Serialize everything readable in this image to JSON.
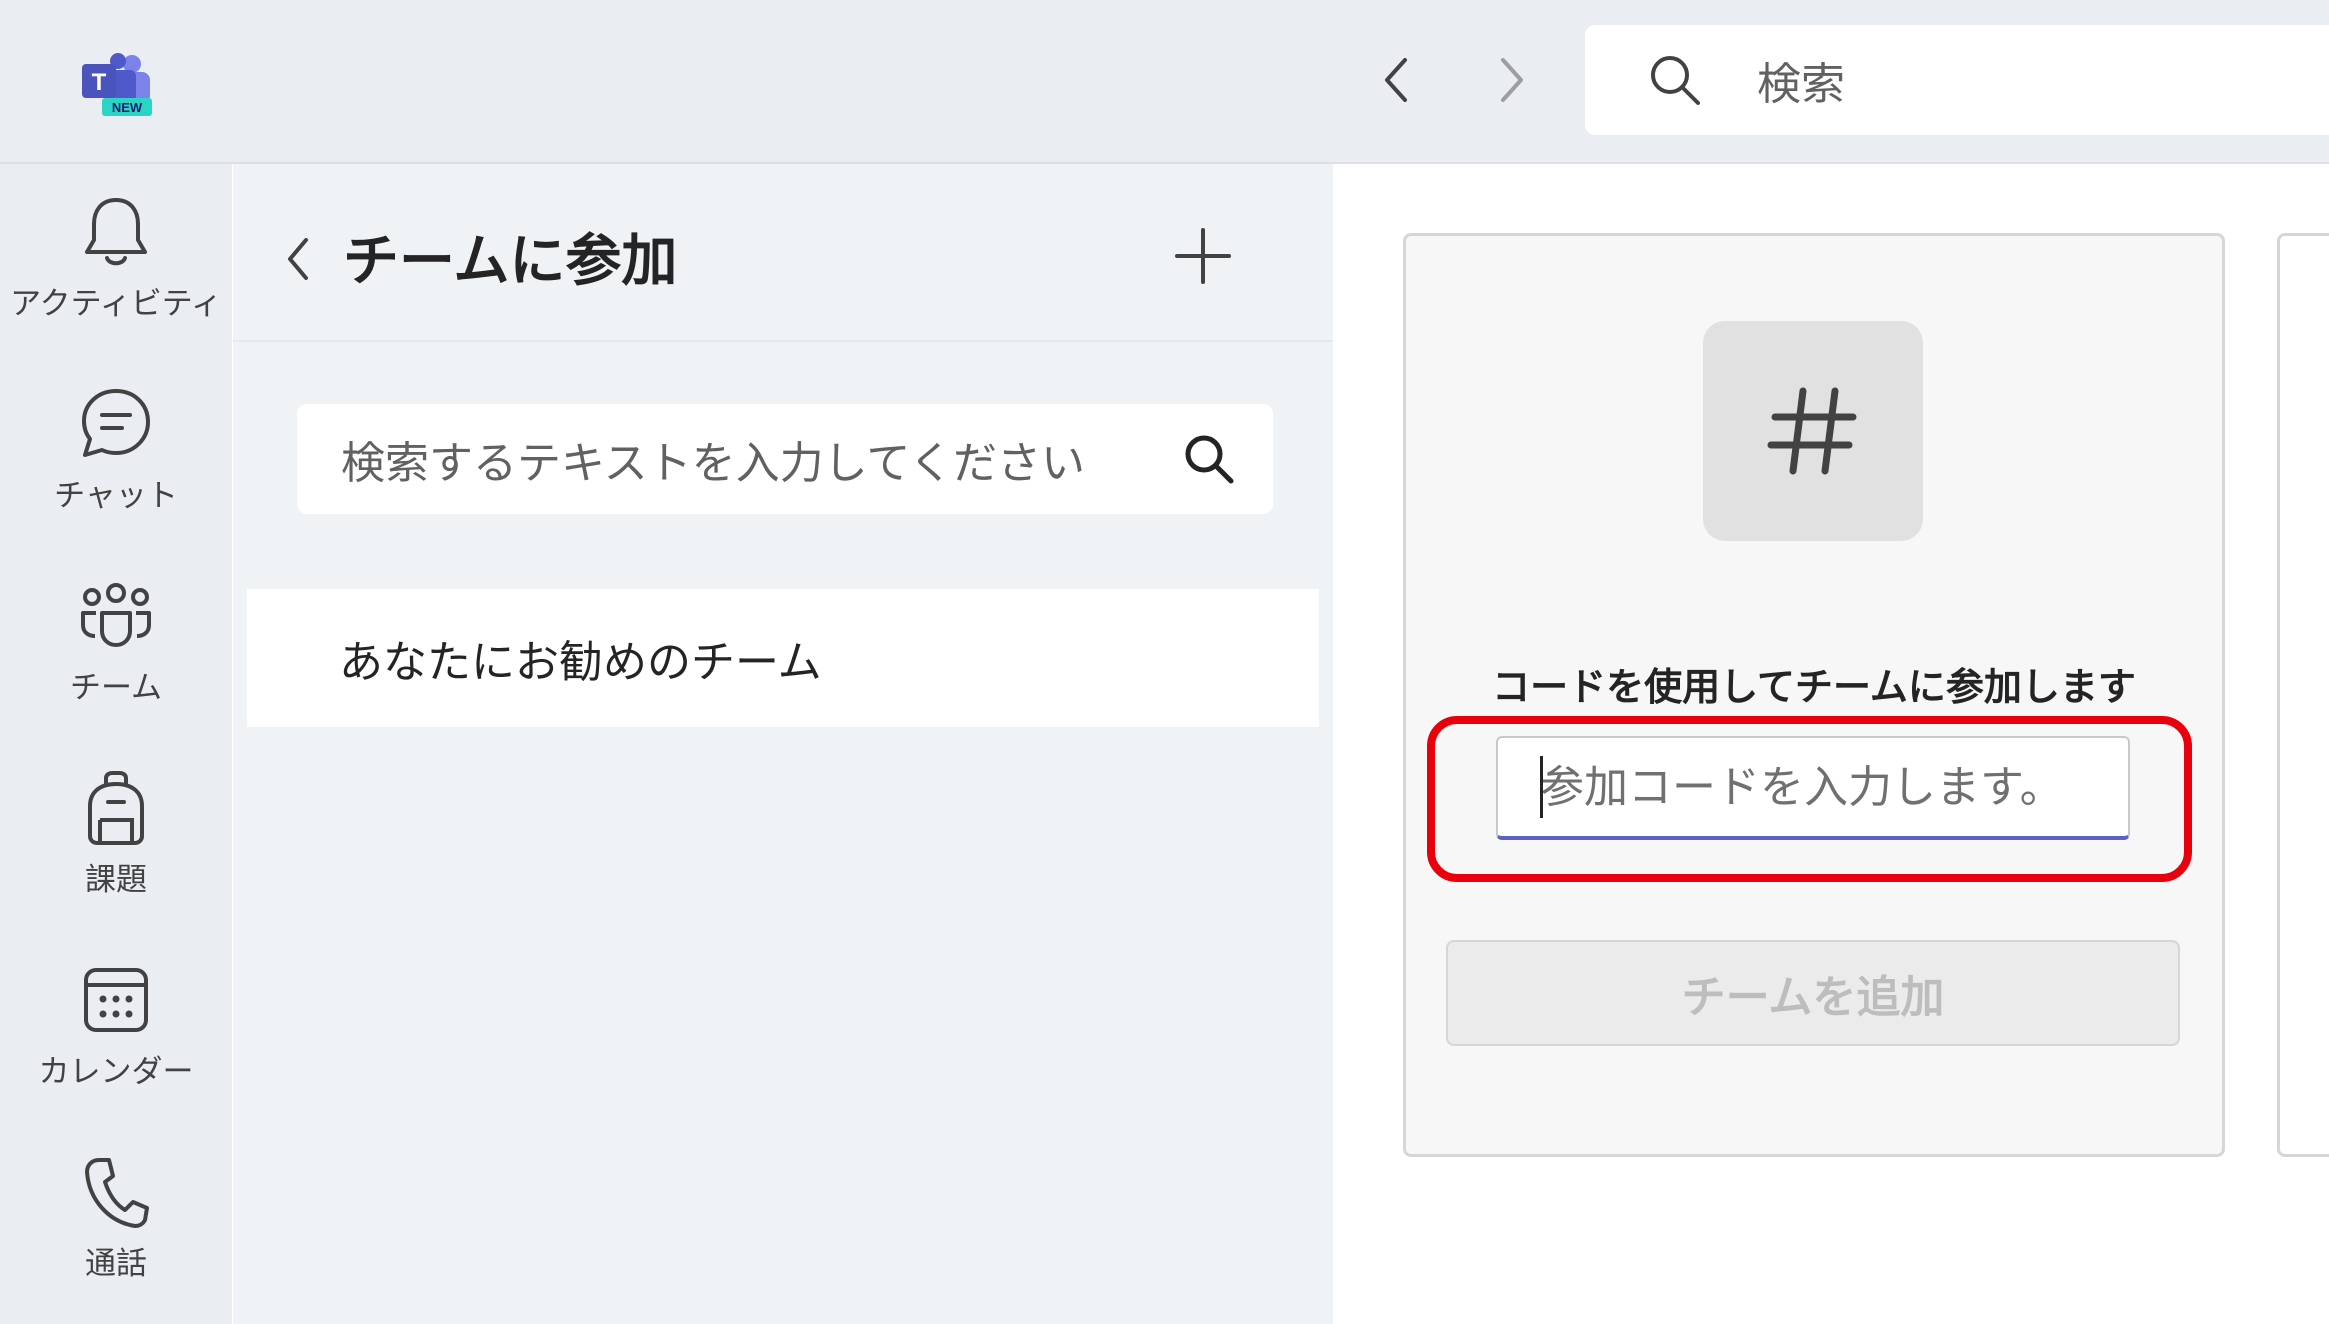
{
  "app": {
    "logo_badge": "NEW",
    "logo_letter": "T"
  },
  "topbar": {
    "search_placeholder": "検索"
  },
  "rail": {
    "items": [
      {
        "label": "アクティビティ",
        "icon": "bell-icon"
      },
      {
        "label": "チャット",
        "icon": "chat-icon"
      },
      {
        "label": "チーム",
        "icon": "teams-icon"
      },
      {
        "label": "課題",
        "icon": "backpack-icon"
      },
      {
        "label": "カレンダー",
        "icon": "calendar-icon"
      },
      {
        "label": "通話",
        "icon": "phone-icon"
      }
    ]
  },
  "panel": {
    "title": "チームに参加",
    "search_placeholder": "検索するテキストを入力してください",
    "recommended_label": "あなたにお勧めのチーム"
  },
  "join_card": {
    "label": "コードを使用してチームに参加します",
    "input_placeholder": "参加コードを入力します。",
    "input_value": "",
    "button_label": "チームを追加"
  },
  "colors": {
    "accent": "#5b5fc7",
    "highlight": "#e8000d",
    "rail_bg": "#eaedf1",
    "panel_bg": "#f0f3f6"
  }
}
